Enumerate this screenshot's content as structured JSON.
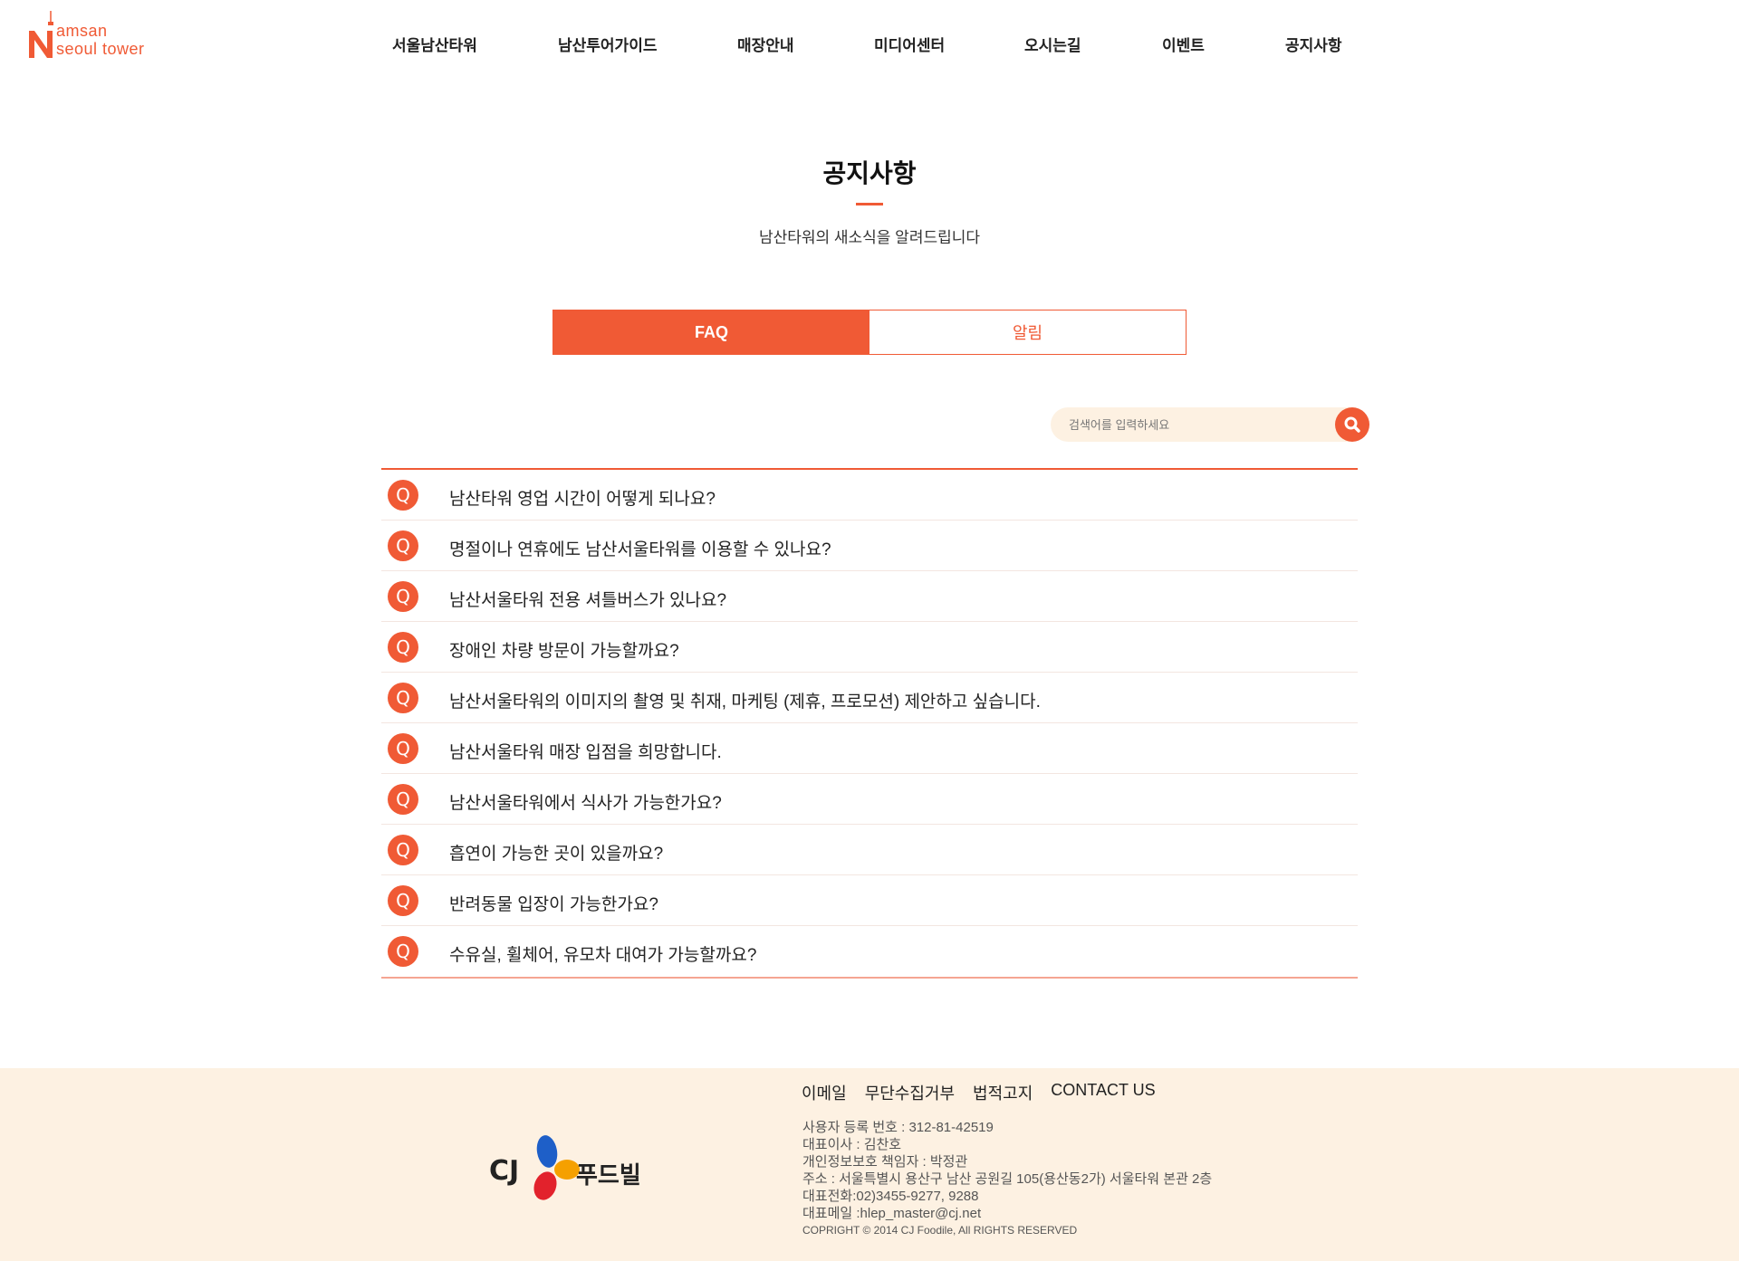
{
  "logo": {
    "line1": "amsan",
    "line2": "seoul tower",
    "letter": "N"
  },
  "nav": {
    "items": [
      "서울남산타워",
      "남산투어가이드",
      "매장안내",
      "미디어센터",
      "오시는길",
      "이벤트",
      "공지사항"
    ]
  },
  "page": {
    "title": "공지사항",
    "subtitle": "남산타워의 새소식을 알려드립니다"
  },
  "tabs": [
    {
      "label": "FAQ",
      "active": true
    },
    {
      "label": "알림",
      "active": false
    }
  ],
  "search": {
    "placeholder": "검색어를 입력하세요",
    "icon": "search-icon"
  },
  "faq": {
    "badge": "Q",
    "items": [
      "남산타워 영업 시간이 어떻게 되나요?",
      "명절이나 연휴에도 남산서울타워를 이용할 수 있나요?",
      "남산서울타워 전용 셔틀버스가 있나요?",
      "장애인 차량 방문이 가능할까요?",
      "남산서울타워의 이미지의 촬영 및 취재, 마케팅 (제휴, 프로모션) 제안하고 싶습니다.",
      "남산서울타워 매장 입점을 희망합니다.",
      "남산서울타워에서 식사가 가능한가요?",
      "흡연이 가능한 곳이 있을까요?",
      "반려동물 입장이 가능한가요?",
      "수유실, 휠체어, 유모차 대여가 가능할까요?"
    ]
  },
  "footer": {
    "logo_text": "CJ",
    "brand": "푸드빌",
    "links": [
      "이메일",
      "무단수집거부",
      "법적고지",
      "CONTACT US"
    ],
    "info": [
      "사용자 등록 번호 : 312-81-42519",
      "대표이사 : 김찬호",
      "개인정보보호 책임자 : 박정관",
      "주소 : 서울특별시 용산구 남산 공원길 105(용산동2가) 서울타워 본관 2층",
      "대표전화:02)3455-9277, 9288",
      "대표메일 :hlep_master@cj.net"
    ],
    "copyright": "COPRIGHT © 2014 CJ Foodile, All RIGHTS RESERVED"
  },
  "colors": {
    "accent": "#f05a35",
    "footer_bg": "#fdf1e2",
    "search_bg": "#fdf1e2"
  }
}
